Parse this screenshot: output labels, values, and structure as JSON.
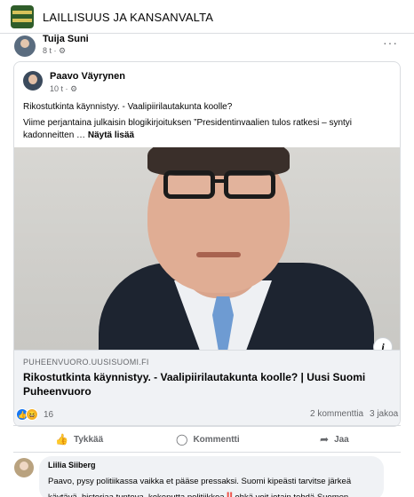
{
  "group": {
    "title": "LAILLISUUS JA KANSANVALTA"
  },
  "post": {
    "author": "Tuija Suni",
    "meta": "8 t · ⚙",
    "more_icon": "···"
  },
  "shared": {
    "author": "Paavo Väyrynen",
    "meta": "10 t · ⚙",
    "line1": "Rikostutkinta käynnistyy. - Vaalipiirilautakunta koolle?",
    "line2": "Viime perjantaina julkaisin blogikirjoituksen ”Presidentinvaalien tulos ratkesi – syntyi kadonneitten …",
    "see_more": "Näytä lisää",
    "info_icon": "i",
    "link": {
      "domain": "PUHEENVUORO.UUSISUOMI.FI",
      "title": "Rikostutkinta käynnistyy. - Vaalipiirilautakunta koolle? | Uusi Suomi Puheenvuoro"
    }
  },
  "stats": {
    "reactions_count": "16",
    "comments": "2 kommenttia",
    "shares": "3 jakoa"
  },
  "actions": {
    "like": "Tykkää",
    "comment": "Kommentti",
    "share": "Jaa"
  },
  "comment": {
    "author": "Liilia Siiberg",
    "text": "Paavo, pysy politiikassa vaikka et pääse pressaksi. Suomi kipeästi tarvitse järkeä käytävä, historiaa tunteva, kokenutta politiikkoa‼️ehkä voit jotain tehdä Suomen hyväksi ja kansalaiset ovat USA:n ja NATO‼️"
  },
  "icons": {
    "like_reaction": "like-icon",
    "haha_reaction": "haha-icon",
    "like_action": "thumb-up-icon",
    "comment_action": "speech-bubble-icon",
    "share_action": "share-arrow-icon"
  },
  "colors": {
    "accent": "#1877f2",
    "haha": "#f7b125"
  }
}
